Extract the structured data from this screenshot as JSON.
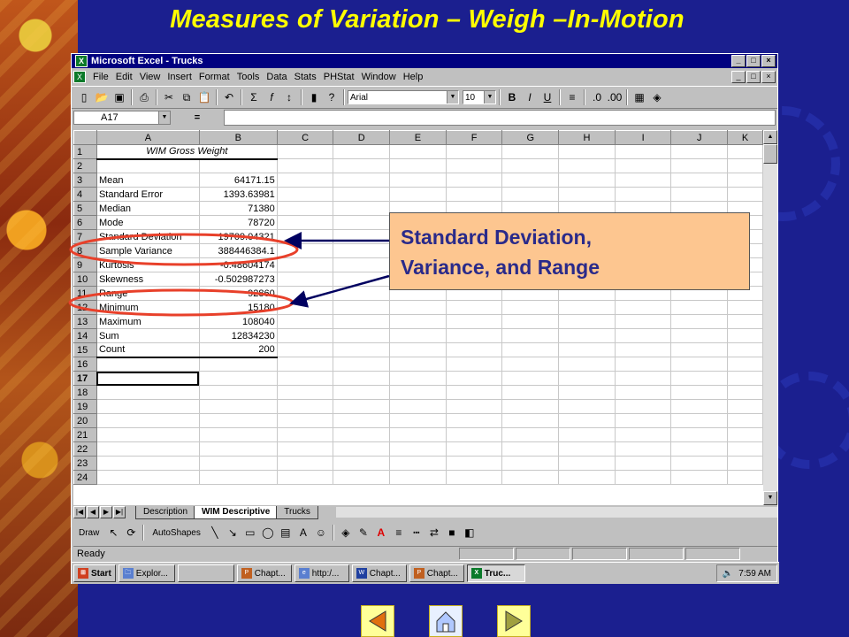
{
  "slide": {
    "title": "Measures of Variation – Weigh –In-Motion"
  },
  "window": {
    "title": "Microsoft Excel - Trucks",
    "app_icon": "excel-icon"
  },
  "menu": [
    "File",
    "Edit",
    "View",
    "Insert",
    "Format",
    "Tools",
    "Data",
    "Stats",
    "PHStat",
    "Window",
    "Help"
  ],
  "toolbar": {
    "font": "Arial",
    "size": "10"
  },
  "formula_bar": {
    "name_box": "A17",
    "equals": "="
  },
  "columns": [
    "A",
    "B",
    "C",
    "D",
    "E",
    "F",
    "G",
    "H",
    "I",
    "J",
    "K"
  ],
  "rows": [
    {
      "n": "1",
      "a": "WIM Gross Weight",
      "b": ""
    },
    {
      "n": "2",
      "a": "",
      "b": ""
    },
    {
      "n": "3",
      "a": "Mean",
      "b": "64171.15"
    },
    {
      "n": "4",
      "a": "Standard Error",
      "b": "1393.63981"
    },
    {
      "n": "5",
      "a": "Median",
      "b": "71380"
    },
    {
      "n": "6",
      "a": "Mode",
      "b": "78720"
    },
    {
      "n": "7",
      "a": "Standard Deviation",
      "b": "19709.04321"
    },
    {
      "n": "8",
      "a": "Sample Variance",
      "b": "388446384.1"
    },
    {
      "n": "9",
      "a": "Kurtosis",
      "b": "-0.48604174"
    },
    {
      "n": "10",
      "a": "Skewness",
      "b": "-0.502987273"
    },
    {
      "n": "11",
      "a": "Range",
      "b": "92860"
    },
    {
      "n": "12",
      "a": "Minimum",
      "b": "15180"
    },
    {
      "n": "13",
      "a": "Maximum",
      "b": "108040"
    },
    {
      "n": "14",
      "a": "Sum",
      "b": "12834230"
    },
    {
      "n": "15",
      "a": "Count",
      "b": "200"
    },
    {
      "n": "16",
      "a": "",
      "b": ""
    },
    {
      "n": "17",
      "a": "",
      "b": ""
    },
    {
      "n": "18",
      "a": "",
      "b": ""
    },
    {
      "n": "19",
      "a": "",
      "b": ""
    },
    {
      "n": "20",
      "a": "",
      "b": ""
    },
    {
      "n": "21",
      "a": "",
      "b": ""
    },
    {
      "n": "22",
      "a": "",
      "b": ""
    },
    {
      "n": "23",
      "a": "",
      "b": ""
    },
    {
      "n": "24",
      "a": "",
      "b": ""
    }
  ],
  "tabs": [
    "Description",
    "WIM Descriptive",
    "Trucks"
  ],
  "active_tab": "WIM Descriptive",
  "drawing": {
    "draw": "Draw",
    "autoshapes": "AutoShapes"
  },
  "status": {
    "text": "Ready"
  },
  "taskbar": {
    "start": "Start",
    "items": [
      "Explor...",
      "",
      "Chapt...",
      "http:/...",
      "Chapt...",
      "Chapt...",
      "Truc..."
    ],
    "clock": "7:59 AM"
  },
  "callout": {
    "line1": "Standard Deviation,",
    "line2": "Variance, and Range"
  },
  "colors": {
    "title": "#ffff00",
    "callout_bg": "#fdc690",
    "callout_text": "#2a2a8a",
    "highlight": "#e8402a",
    "window_title": "#000080"
  }
}
